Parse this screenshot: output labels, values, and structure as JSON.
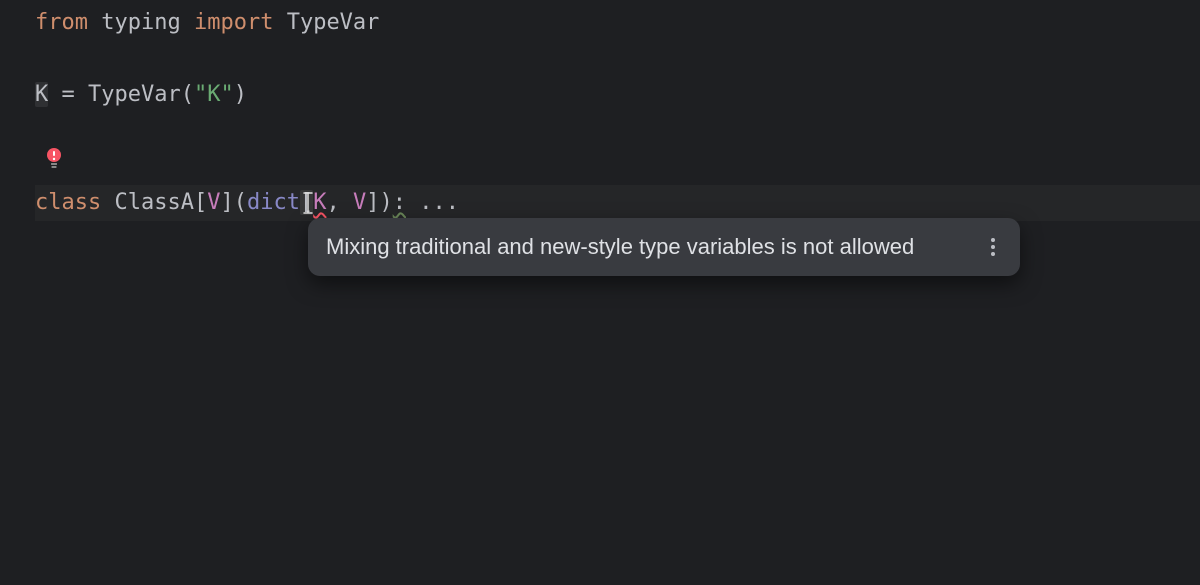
{
  "code": {
    "line1": {
      "from": "from",
      "module": "typing",
      "import": "import",
      "name": "TypeVar"
    },
    "line3": {
      "var": "K",
      "eq": " = ",
      "fn": "TypeVar",
      "paren_open": "(",
      "str": "\"K\"",
      "paren_close": ")"
    },
    "line6": {
      "class_kw": "class",
      "classname": "ClassA",
      "bracket_open": "[",
      "typevar": "V",
      "bracket_close": "]",
      "paren_open": "(",
      "base": "dict",
      "sub_open": "[",
      "k": "K",
      "comma": ", ",
      "v": "V",
      "sub_close": "]",
      "paren_close": ")",
      "colon": ":",
      "body": " ..."
    }
  },
  "tooltip": {
    "message": "Mixing traditional and new-style type variables is not allowed"
  },
  "icons": {
    "lightbulb": "error-lightbulb-icon",
    "cursor": "text-cursor",
    "more": "more-vertical"
  }
}
